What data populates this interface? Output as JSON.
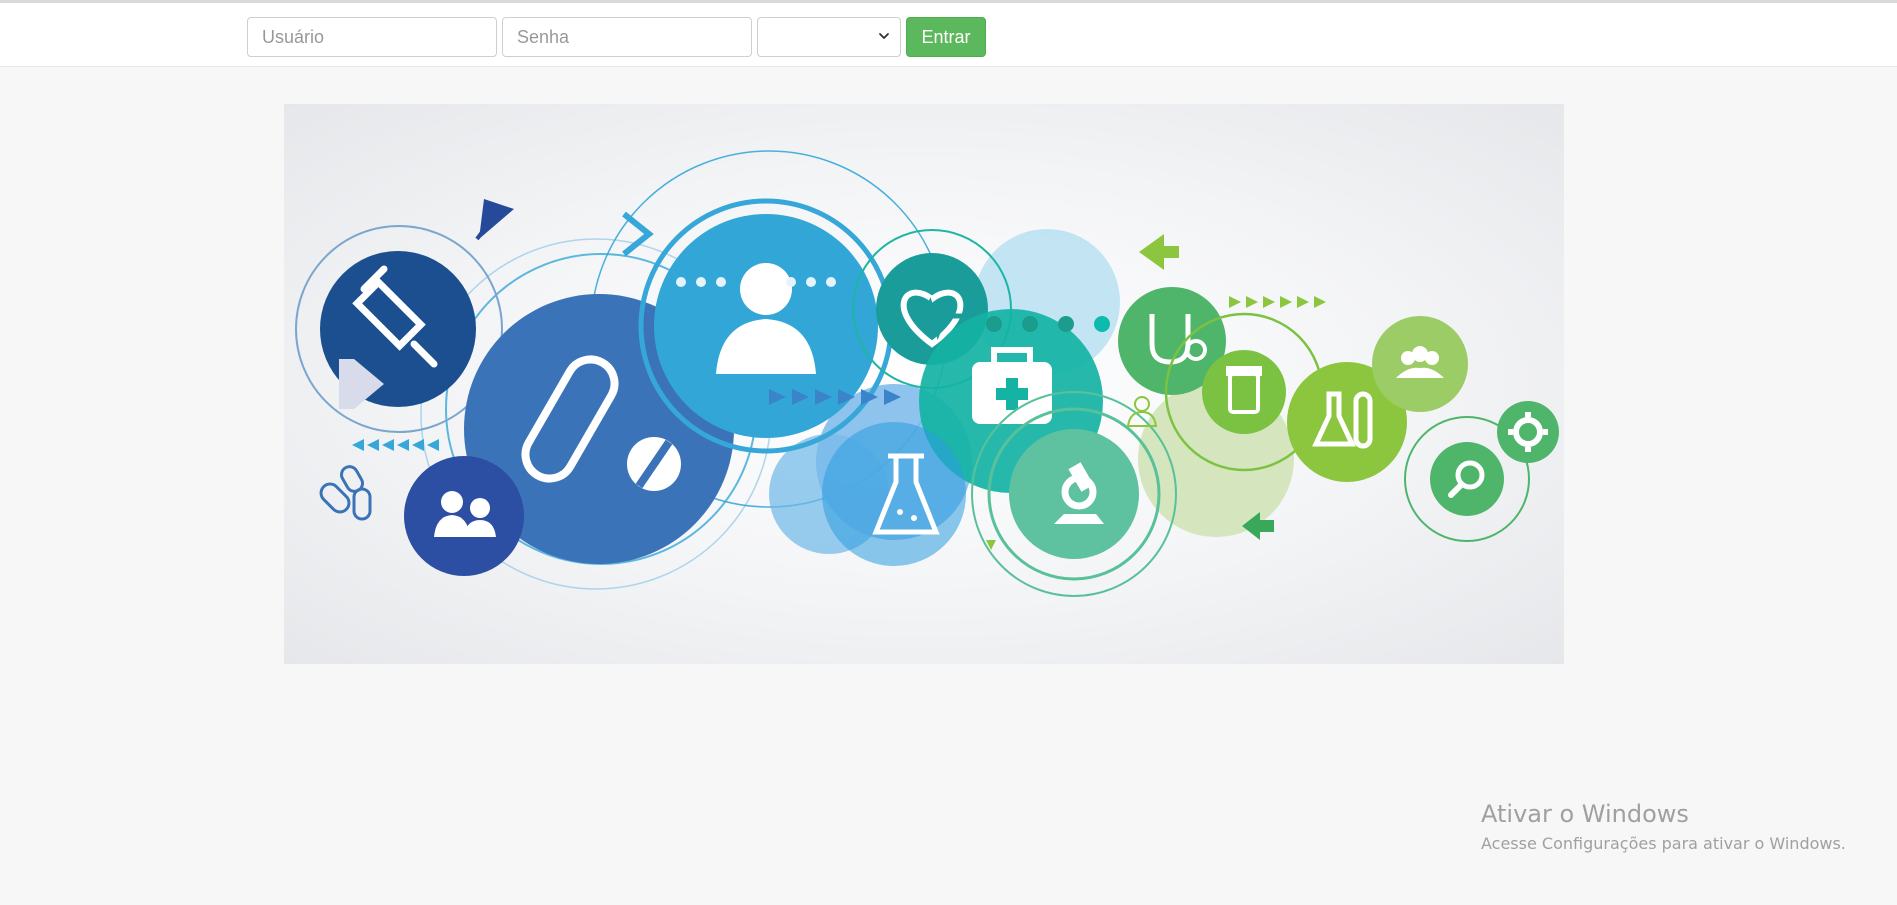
{
  "login": {
    "user_placeholder": "Usuário",
    "pass_placeholder": "Senha",
    "select_value": "",
    "submit_label": "Entrar"
  },
  "hero": {
    "icons": [
      "syringe-icon",
      "pill-icon",
      "user-icon",
      "heartbeat-icon",
      "first-aid-kit-icon",
      "stethoscope-icon",
      "pill-bottle-icon",
      "flasks-icon",
      "group-icon",
      "microscope-icon",
      "lab-flask-icon",
      "people-icon",
      "magnifier-icon",
      "gear-icon",
      "capsules-icon"
    ]
  },
  "watermark": {
    "title": "Ativar o Windows",
    "subtitle": "Acesse Configurações para ativar o Windows."
  },
  "colors": {
    "button_green": "#5cb85c",
    "page_bg": "#f7f7f7",
    "blue_dark": "#1b4f8f",
    "blue_mid": "#3b73b9",
    "blue_light": "#36a7d8",
    "teal": "#1fb5a5",
    "green": "#4fb56b",
    "lime": "#8cc63f"
  }
}
